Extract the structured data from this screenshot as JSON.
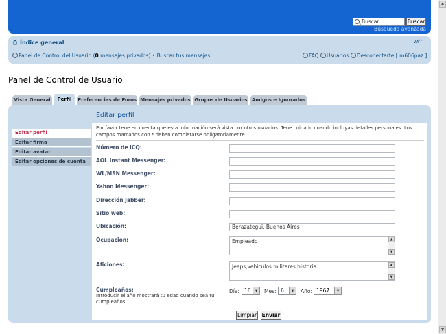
{
  "header": {
    "search_placeholder": "Buscar...",
    "search_button": "Buscar",
    "advanced_search": "Búsqueda avanzada"
  },
  "navbar": {
    "index_link": "Índice general",
    "ucp_link": "Panel de Control del Usuario (",
    "private_count": "0",
    "private_suffix": " mensajes privados)",
    "separator": " • ",
    "search_posts": "Buscar tus mensajes",
    "faq": "FAQ",
    "users": "Usuarios",
    "logout": "Desconectarte [ m606paz ]"
  },
  "page_title": "Panel de Control de Usuario",
  "tabs": [
    {
      "label": "Vista General"
    },
    {
      "label": "Perfil"
    },
    {
      "label": "Preferencias de Foros"
    },
    {
      "label": "Mensajes privados"
    },
    {
      "label": "Grupos de Usuarios"
    },
    {
      "label": "Amigos e Ignorados"
    }
  ],
  "sidebar": [
    {
      "label": "Editar perfil"
    },
    {
      "label": "Editar firma"
    },
    {
      "label": "Editar avatar"
    },
    {
      "label": "Editar opciones de cuenta"
    }
  ],
  "form": {
    "title": "Editar perfil",
    "intro": "Por favor tene en cuenta que esta información será vista por otros usuarios. Tene cuidado cuando incluyas detalles personales. Los campos marcados con * deben completarse obligatoriamente.",
    "fields": [
      {
        "label": "Número de ICQ:",
        "value": ""
      },
      {
        "label": "AOL Instant Messenger:",
        "value": ""
      },
      {
        "label": "WL/MSN Messenger:",
        "value": ""
      },
      {
        "label": "Yahoo Messenger:",
        "value": ""
      },
      {
        "label": "Dirección Jabber:",
        "value": ""
      },
      {
        "label": "Sitio web:",
        "value": ""
      },
      {
        "label": "Ubicación:",
        "value": "Berazategui, Buenos Aires"
      }
    ],
    "occupation": {
      "label": "Ocupación:",
      "value": "Empleado"
    },
    "interests": {
      "label": "Aficiones:",
      "value": "Jeeps,vehiculos militares,historia"
    },
    "birthday": {
      "label": "Cumpleaños:",
      "help": "Introducir el año mostrará tu edad cuando sea tu cumpleaños.",
      "day_label": "Día:",
      "day": "16",
      "month_label": "Mes:",
      "month": "6",
      "year_label": "Año:",
      "year": "1967"
    },
    "reset_button": "Limpiar",
    "submit_button": "Enviar"
  }
}
